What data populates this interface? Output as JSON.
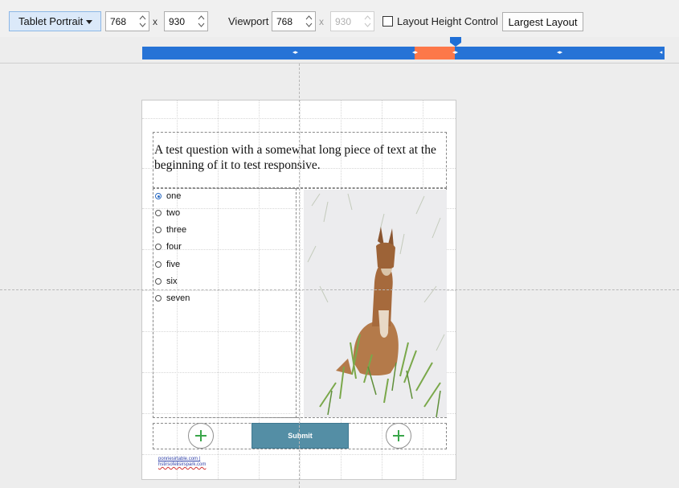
{
  "toolbar": {
    "preset": "Tablet Portrait",
    "width": "768",
    "height": "930",
    "x_sep": "x",
    "viewport_label": "Viewport",
    "viewport_width": "768",
    "viewport_height": "930",
    "layout_height_label": "Layout Height Control",
    "layout_height_checked": false,
    "largest_layout_label": "Largest Layout"
  },
  "breakpoints": {
    "segment_colors": [
      "#2673d6",
      "#fd7849"
    ],
    "active_index": 2,
    "marker_color": "#1f6fd6"
  },
  "canvas": {
    "question": "A test question with a somewhat long piece of text at the beginning of it to test responsive.",
    "options": [
      {
        "label": "one",
        "selected": true
      },
      {
        "label": "two",
        "selected": false
      },
      {
        "label": "three",
        "selected": false
      },
      {
        "label": "four",
        "selected": false
      },
      {
        "label": "five",
        "selected": false
      },
      {
        "label": "six",
        "selected": false
      },
      {
        "label": "seven",
        "selected": false
      }
    ],
    "submit_label": "Submit",
    "footer_line1": "ponriesirtable.com |",
    "footer_line2": "hstirsofelisirspark.com",
    "add_icon_color": "#3aa64a",
    "submit_color": "#548ea5"
  }
}
